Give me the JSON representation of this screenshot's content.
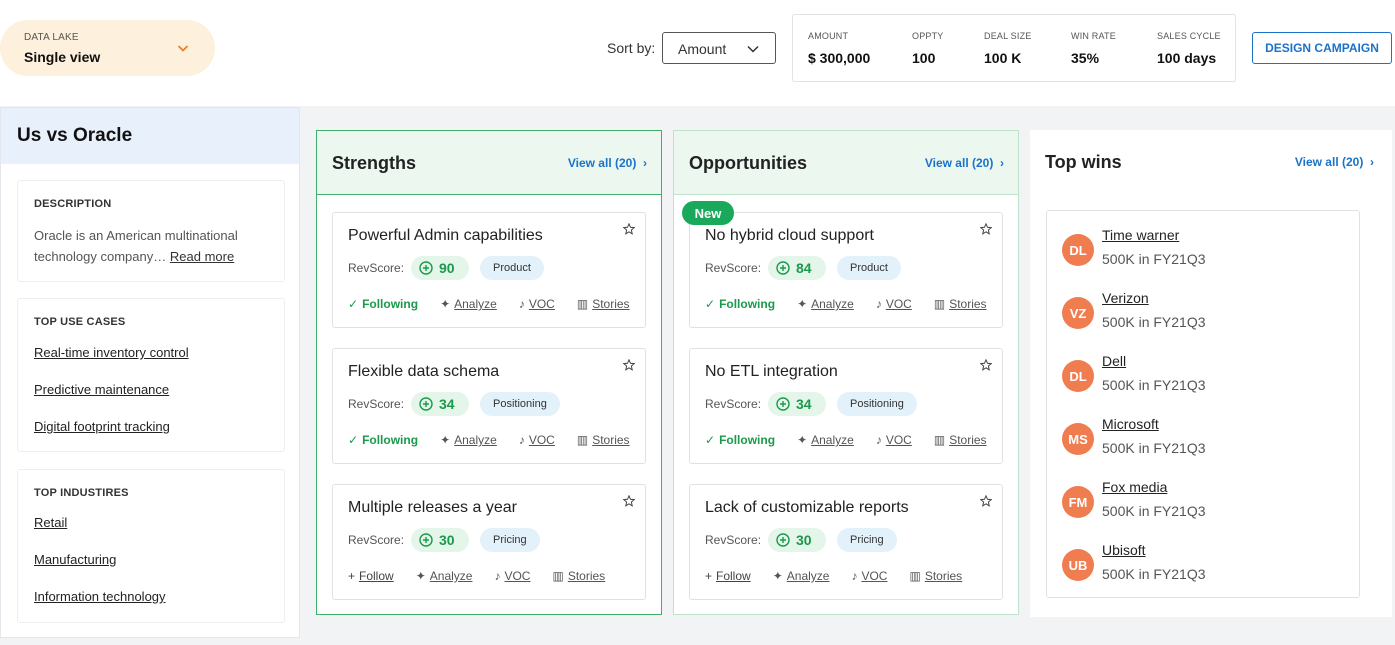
{
  "data_lake": {
    "label": "DATA LAKE",
    "value": "Single view"
  },
  "sort": {
    "label": "Sort by:",
    "value": "Amount"
  },
  "metrics": [
    {
      "label": "AMOUNT",
      "value": "$ 300,000"
    },
    {
      "label": "OPPTY",
      "value": "100"
    },
    {
      "label": "DEAL SIZE",
      "value": "100 K"
    },
    {
      "label": "WIN RATE",
      "value": "35%"
    },
    {
      "label": "SALES CYCLE",
      "value": "100 days"
    }
  ],
  "design_campaign_label": "DESIGN CAMPAIGN",
  "sidebar": {
    "title": "Us vs Oracle",
    "description": {
      "heading": "DESCRIPTION",
      "text": "Oracle is an American multinational technology company…",
      "read_more": "Read more"
    },
    "use_cases": {
      "heading": "TOP USE CASES",
      "items": [
        "Real-time inventory control",
        "Predictive maintenance",
        "Digital footprint tracking"
      ]
    },
    "industries": {
      "heading": "TOP INDUSTIRES",
      "items": [
        "Retail",
        "Manufacturing",
        "Information technology"
      ]
    }
  },
  "strengths": {
    "title": "Strengths",
    "view_all": "View all (20)",
    "cards": [
      {
        "title": "Powerful Admin capabilities",
        "rev_label": "RevScore:",
        "score": "90",
        "tag": "Product",
        "follow": "Following",
        "analyze": "Analyze",
        "voc": "VOC",
        "stories": "Stories"
      },
      {
        "title": "Flexible data schema",
        "rev_label": "RevScore:",
        "score": "34",
        "tag": "Positioning",
        "follow": "Following",
        "analyze": "Analyze",
        "voc": "VOC",
        "stories": "Stories"
      },
      {
        "title": "Multiple releases a year",
        "rev_label": "RevScore:",
        "score": "30",
        "tag": "Pricing",
        "follow": "Follow",
        "analyze": "Analyze",
        "voc": "VOC",
        "stories": "Stories"
      }
    ]
  },
  "opportunities": {
    "title": "Opportunities",
    "view_all": "View all (20)",
    "new_badge": "New",
    "cards": [
      {
        "title": "No hybrid cloud support",
        "rev_label": "RevScore:",
        "score": "84",
        "tag": "Product",
        "follow": "Following",
        "analyze": "Analyze",
        "voc": "VOC",
        "stories": "Stories"
      },
      {
        "title": "No ETL integration",
        "rev_label": "RevScore:",
        "score": "34",
        "tag": "Positioning",
        "follow": "Following",
        "analyze": "Analyze",
        "voc": "VOC",
        "stories": "Stories"
      },
      {
        "title": "Lack of customizable reports",
        "rev_label": "RevScore:",
        "score": "30",
        "tag": "Pricing",
        "follow": "Follow",
        "analyze": "Analyze",
        "voc": "VOC",
        "stories": "Stories"
      }
    ]
  },
  "top_wins": {
    "title": "Top wins",
    "view_all": "View all (20)",
    "items": [
      {
        "initials": "DL",
        "name": "Time warner",
        "detail": "500K in FY21Q3"
      },
      {
        "initials": "VZ",
        "name": "Verizon",
        "detail": "500K in FY21Q3"
      },
      {
        "initials": "DL",
        "name": "Dell",
        "detail": "500K in FY21Q3"
      },
      {
        "initials": "MS",
        "name": "Microsoft",
        "detail": "500K in FY21Q3"
      },
      {
        "initials": "FM",
        "name": "Fox media",
        "detail": "500K in FY21Q3"
      },
      {
        "initials": "UB",
        "name": "Ubisoft",
        "detail": "500K in FY21Q3"
      }
    ]
  },
  "colors": {
    "accent_blue": "#1a73c8",
    "green": "#1a9a4a",
    "avatar_orange": "#f07d50",
    "data_lake_bg": "#fdf0dc"
  }
}
